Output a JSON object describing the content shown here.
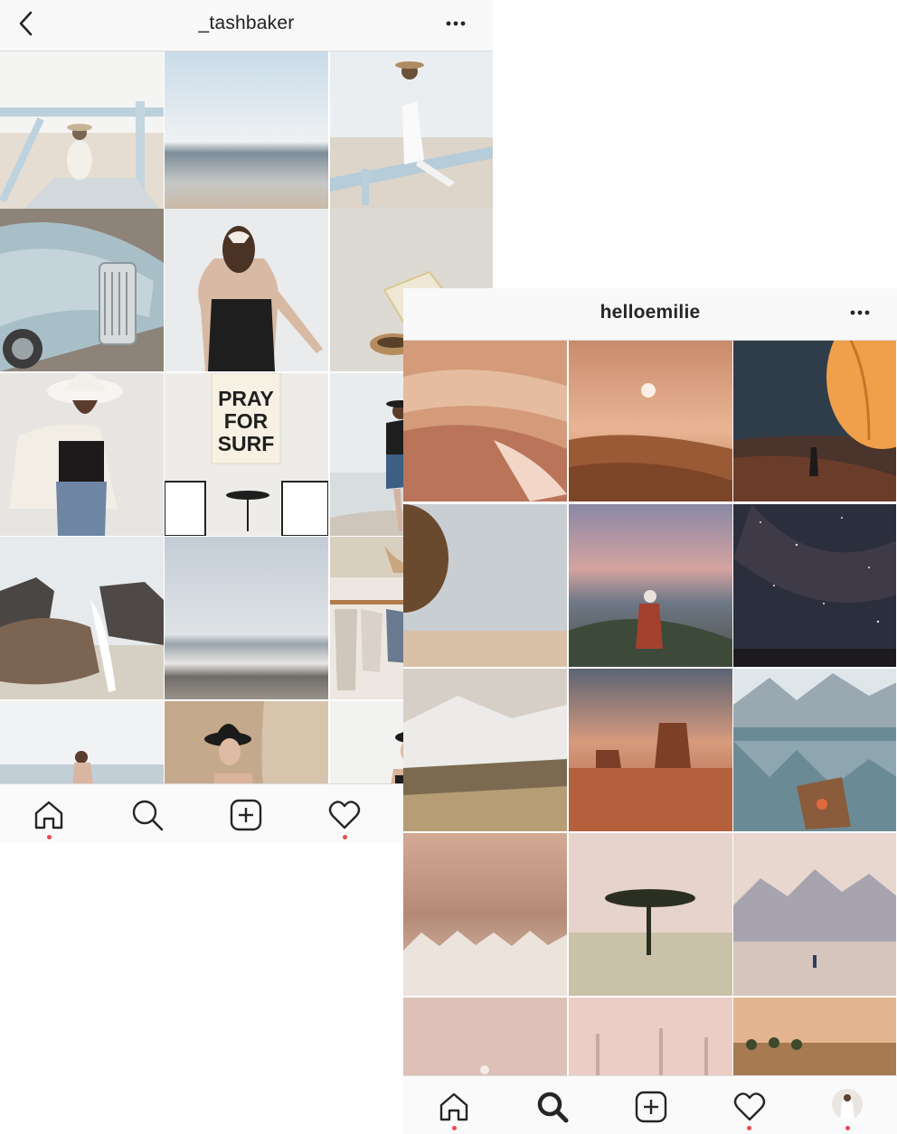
{
  "profile_a": {
    "username": "_tashbaker",
    "header_icons": [
      "back-chevron-icon",
      "more-options-icon"
    ],
    "tabs": [
      "home-icon",
      "search-icon",
      "new-post-icon",
      "activity-heart-icon",
      "profile-avatar"
    ],
    "active_tab": "profile",
    "notification_dots": [
      "home",
      "activity",
      "profile"
    ],
    "posts_visible": 15
  },
  "profile_b": {
    "username": "helloemilie",
    "header_icons": [
      "more-options-icon"
    ],
    "tabs": [
      "home-icon",
      "search-icon",
      "new-post-icon",
      "activity-heart-icon",
      "profile-avatar"
    ],
    "active_tab": "search",
    "notification_dots": [
      "home",
      "activity",
      "profile"
    ],
    "posts_visible": 15
  },
  "colors": {
    "header_bg": "#f9f9f9",
    "border": "#dbdbdb",
    "icon": "#262626",
    "notification_dot": "#ed4956"
  }
}
